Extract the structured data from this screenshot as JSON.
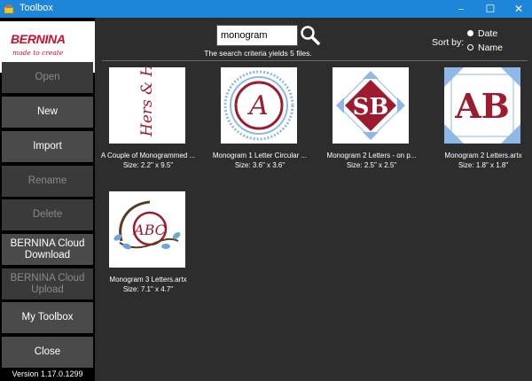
{
  "window": {
    "title": "Toolbox",
    "minimize": "–",
    "maximize": "☐",
    "close": "✕"
  },
  "sidebar": {
    "brand": "BERNINA",
    "tagline": "made to create",
    "buttons": [
      {
        "label": "Open",
        "enabled": false
      },
      {
        "label": "New",
        "enabled": true
      },
      {
        "label": "Import",
        "enabled": true
      },
      {
        "label": "Rename",
        "enabled": false
      },
      {
        "label": "Delete",
        "enabled": false
      },
      {
        "label": "BERNINA Cloud Download",
        "enabled": true
      },
      {
        "label": "BERNINA Cloud Upload",
        "enabled": false
      },
      {
        "label": "My Toolbox",
        "enabled": true
      },
      {
        "label": "Close",
        "enabled": true
      }
    ],
    "version": "Version 1.17.0.1299"
  },
  "search": {
    "value": "monogram",
    "info": "The search criteria yields 5 files."
  },
  "sort": {
    "label": "Sort by:",
    "options": [
      {
        "label": "Date",
        "selected": true
      },
      {
        "label": "Name",
        "selected": false
      }
    ]
  },
  "files": [
    {
      "name": "A Couple of Monogrammed ...",
      "size": "Size: 2.2\" x 9.5\"",
      "thumb_text": "Hers & His"
    },
    {
      "name": "Monogram 1 Letter Circular ...",
      "size": "Size: 3.6\" x 3.6\"",
      "thumb_text": "A"
    },
    {
      "name": "Monogram 2 Letters - on p...",
      "size": "Size: 2.5\" x 2.5\"",
      "thumb_text": "SB"
    },
    {
      "name": "Monogram 2 Letters.artx",
      "size": "Size: 1.8\" x 1.8\"",
      "thumb_text": "AB"
    },
    {
      "name": "Monogram 3 Letters.artx",
      "size": "Size: 7.1\" x 4.7\"",
      "thumb_text": "ABC"
    }
  ],
  "colors": {
    "titlebar": "#1e86d8",
    "brand_red": "#c8102e",
    "monogram_red": "#9e1b2f",
    "accent_blue": "#8fb8e8",
    "panel": "#2d2d2d"
  }
}
